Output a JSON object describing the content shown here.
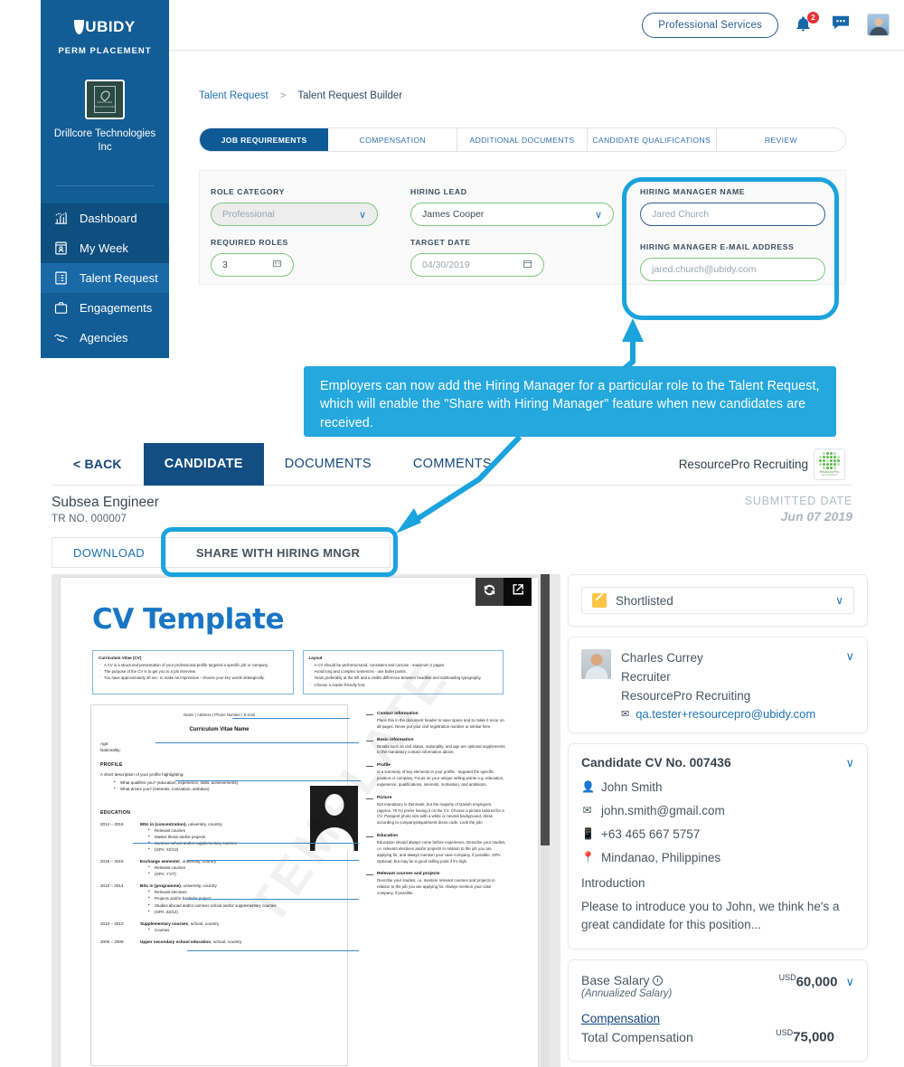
{
  "sidebar": {
    "brand": "UBIDY",
    "brand_sub": "PERM PLACEMENT",
    "company": "Drillcore Technologies Inc",
    "logo_caption": "DRILLCORE",
    "logo_caption2": "TECHNOLOGIES",
    "items": [
      {
        "label": "Dashboard",
        "icon": "chart-icon",
        "state": "dim"
      },
      {
        "label": "My Week",
        "icon": "calendar-person-icon",
        "state": "dim"
      },
      {
        "label": "Talent Request",
        "icon": "clipboard-list-icon",
        "state": "active"
      },
      {
        "label": "Engagements",
        "icon": "briefcase-icon",
        "state": "normal"
      },
      {
        "label": "Agencies",
        "icon": "handshake-icon",
        "state": "normal"
      }
    ]
  },
  "topbar": {
    "pill": "Professional Services",
    "notification_count": "2"
  },
  "breadcrumb": {
    "parent": "Talent Request",
    "separator": ">",
    "current": "Talent Request Builder"
  },
  "builder_tabs": [
    {
      "label": "JOB REQUIREMENTS",
      "active": true
    },
    {
      "label": "COMPENSATION",
      "active": false
    },
    {
      "label": "ADDITIONAL DOCUMENTS",
      "active": false
    },
    {
      "label": "CANDIDATE QUALIFICATIONS",
      "active": false
    },
    {
      "label": "REVIEW",
      "active": false
    }
  ],
  "form": {
    "role_category": {
      "label": "ROLE CATEGORY",
      "value": "Professional",
      "disabled": true
    },
    "hiring_lead": {
      "label": "HIRING LEAD",
      "value": "James Cooper"
    },
    "required_roles": {
      "label": "REQUIRED ROLES",
      "value": "3"
    },
    "target_date": {
      "label": "TARGET DATE",
      "value": "04/30/2019"
    },
    "hiring_manager_name": {
      "label": "HIRING MANAGER NAME",
      "value": "Jared Church"
    },
    "hiring_manager_email": {
      "label": "HIRING MANAGER E-MAIL ADDRESS",
      "value": "jared.church@ubidy.com"
    }
  },
  "callout": {
    "text": "Employers can now add the Hiring Manager for a particular role to the Talent Request, which will enable the \"Share with Hiring Manager\" feature when new candidates are received."
  },
  "candidate_view": {
    "back": "< BACK",
    "tabs": [
      {
        "label": "CANDIDATE",
        "active": true
      },
      {
        "label": "DOCUMENTS",
        "active": false
      },
      {
        "label": "COMMENTS",
        "active": false
      }
    ],
    "agency": "ResourcePro Recruiting",
    "agency_logo_caption": "ResourcePro",
    "agency_logo_caption2": "RECRUITMENT",
    "job_title": "Subsea Engineer",
    "tr_no": "TR NO. 000007",
    "submitted_label": "SUBMITTED DATE",
    "submitted_value": "Jun 07 2019",
    "download_button": "DOWNLOAD",
    "share_button": "SHARE WITH HIRING MNGR"
  },
  "cv_document": {
    "title": "CV Template",
    "watermark": "TEMPLATE",
    "boxes": [
      {
        "heading": "Curriculum Vitae (CV)",
        "items": [
          "A CV is a structured presentation of your professional profile targeted a specific job or company.",
          "The purpose of the CV is to get you to a job interview.",
          "You have approximately 30 sec. to make an impression - choose your key words strategically."
        ]
      },
      {
        "heading": "Layout",
        "items": [
          "A CV should be well-structured, consistent and concise - maximum 2 pages.",
          "Avoid long and complex sentences - use bullet points.",
          "Years preferably at the left and a visible difference between headline and subheading typography.",
          "Choose a reader-friendly font."
        ]
      }
    ],
    "header_line": "Name | Address | Phone Number | E-mail",
    "cv_name": "Curriculum Vitae Name",
    "age_label": "Age:",
    "nationality_label": "Nationality:",
    "profile_heading": "PROFILE",
    "profile_intro": "A short description of your profile highlighting:",
    "profile_items": [
      "What qualifies you? (education, experience, skills, achievements)",
      "What drives you? (interests, motivation, ambition)"
    ],
    "education_heading": "EDUCATION",
    "education": [
      {
        "years": "2014 – 2016",
        "title_bold": "MSc in (concentration)",
        "title_rest": ", university, country",
        "items": [
          "Relevant courses",
          "Master thesis and/or projects",
          "Summer school and/or supplementary courses",
          "(GPA: XX/12)"
        ]
      },
      {
        "years": "2015 – 2015",
        "title_bold": "Exchange semester",
        "title_rest": ", university, country",
        "items": [
          "Relevant courses",
          "(GPA: YY/7)"
        ]
      },
      {
        "years": "2010 – 2014",
        "title_bold": "BSc in (programme)",
        "title_rest": ", university, country",
        "items": [
          "Relevant electives",
          "Projects and/or bachelor project",
          "Studies abroad and/or summer school and/or supplementary courses",
          "(GPA: ZZ/12)"
        ]
      },
      {
        "years": "2010 – 2010",
        "title_bold": "Supplementary courses",
        "title_rest": ", school, country",
        "items": [
          "Courses"
        ]
      },
      {
        "years": "2005 – 2009",
        "title_bold": "Upper secondary school education",
        "title_rest": ", school, country",
        "items": []
      }
    ],
    "notes": [
      {
        "heading": "Contact information",
        "body": "Place this in the document header to save space and to make it recur on all pages. Never put your civil registration number or similar here."
      },
      {
        "heading": "Basic information",
        "body": "Details such as civil status, nationality, and age are optional supplements to the mandatory contact information above."
      },
      {
        "heading": "Profile",
        "body": "Is a summary of key elements in your profile - targeted the specific position or company. Focus on your unique selling points e.g. education, experience, qualifications, interests, motivation, and ambitions."
      },
      {
        "heading": "Picture",
        "body": "Not mandatory in Denmark, but the majority of Danish employers (approx. 70 %) prefer having it on the CV. Choose a picture tailored for a CV. Passport photo size with a white or neutral background, dress according to company/department dress code. Look the job!"
      },
      {
        "heading": "Education",
        "body": "Education should always come before experience. Describe your studies, i.e. relevant electives and/or projects in relation to the job you are applying for, and always mention your case company, if possible. GPA: Optional, but may be a good selling point if it's high."
      },
      {
        "heading": "Relevant courses and projects",
        "body": "Describe your studies, i.e. mention relevant courses and projects in relation to the job you are applying for. Always mention your case company, if possible."
      }
    ]
  },
  "right_panel": {
    "status": "Shortlisted",
    "recruiter": {
      "name": "Charles Currey",
      "role": "Recruiter",
      "company": "ResourcePro Recruiting",
      "email": "qa.tester+resourcepro@ubidy.com"
    },
    "candidate": {
      "cv_no_title": "Candidate CV No. 007436",
      "name": "John Smith",
      "email": "john.smith@gmail.com",
      "phone": "+63 465 667 5757",
      "location": "Mindanao, Philippines",
      "intro_label": "Introduction",
      "intro_text": "Please to introduce you to John, we think he's a great candidate for this position..."
    },
    "salary": {
      "base_label": "Base Salary",
      "base_sub": "(Annualized Salary)",
      "base_currency": "USD",
      "base_amount": "60,000",
      "comp_link": "Compensation",
      "total_label": "Total Compensation",
      "total_currency": "USD",
      "total_amount": "75,000"
    }
  },
  "colors": {
    "sidebar_blue": "#125d96",
    "accent_blue": "#1d74b8",
    "callout_cyan": "#24a8dd",
    "highlight_cyan": "#1ba3de",
    "field_green": "#7ac97e",
    "dark_navy": "#124e82"
  }
}
